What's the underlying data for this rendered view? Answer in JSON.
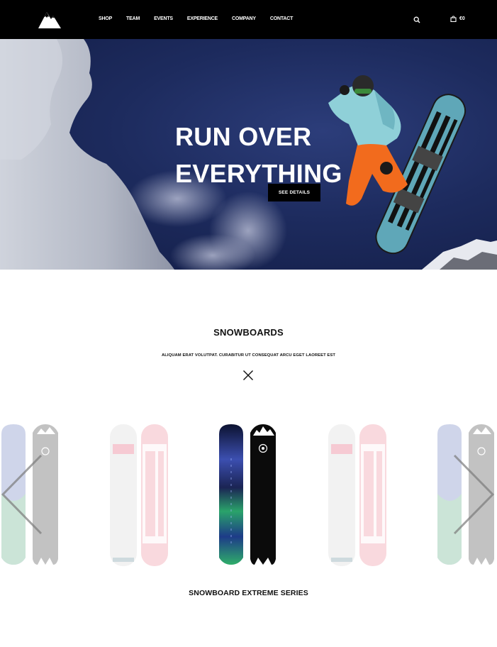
{
  "header": {
    "nav": [
      "SHOP",
      "TEAM",
      "EVENTS",
      "EXPERIENCE",
      "COMPANY",
      "CONTACT"
    ],
    "cart_amount": "€0",
    "icons": {
      "logo": "mountain-logo-icon",
      "search": "search-icon",
      "cart": "shopping-bag-icon"
    }
  },
  "hero": {
    "title_line1": "RUN OVER",
    "title_line2": "EVERYTHING",
    "cta_label": "SEE DETAILS"
  },
  "section": {
    "title": "SNOWBOARDS",
    "subtitle": "ALIQUAM ERAT VOLUTPAT. CURABITUR UT CONSEQUAT ARCU EGET LAOREET EST",
    "divider_icon": "cross-icon"
  },
  "carousel": {
    "prev_icon": "chevron-left-icon",
    "next_icon": "chevron-right-icon",
    "product_title": "SNOWBOARD EXTREME SERIES"
  },
  "colors": {
    "header_bg": "#000000",
    "hero_sky": "#1d2b5e",
    "board_teal": "#4f9bb0",
    "jacket_teal": "#8fd0d8",
    "pants_orange": "#f26b1d"
  }
}
